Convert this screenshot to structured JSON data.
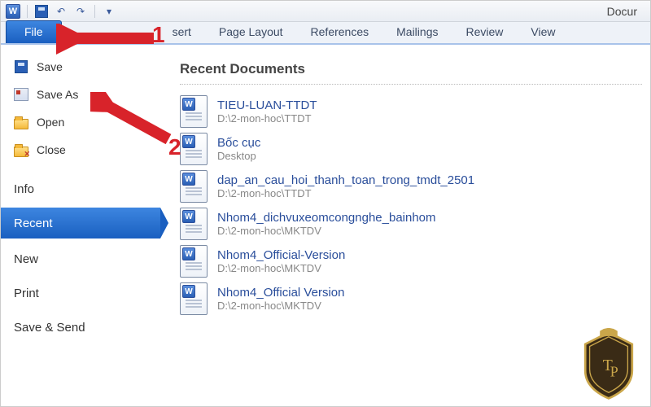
{
  "titlebar": {
    "app_letter": "W",
    "doc_title": "Docur"
  },
  "qat": {
    "save": "save",
    "undo": "↶",
    "redo": "↷"
  },
  "ribbon": {
    "file": "File",
    "insert_cut": "sert",
    "tabs": [
      "Page Layout",
      "References",
      "Mailings",
      "Review",
      "View"
    ]
  },
  "sidebar": {
    "save": "Save",
    "save_as": "Save As",
    "open": "Open",
    "close": "Close",
    "info": "Info",
    "recent": "Recent",
    "new": "New",
    "print": "Print",
    "save_send": "Save & Send"
  },
  "content": {
    "heading": "Recent Documents",
    "docs": [
      {
        "title": "TIEU-LUAN-TTDT",
        "path": "D:\\2-mon-hoc\\TTDT"
      },
      {
        "title": "Bốc cục",
        "path": "Desktop"
      },
      {
        "title": "dap_an_cau_hoi_thanh_toan_trong_tmdt_2501",
        "path": "D:\\2-mon-hoc\\TTDT"
      },
      {
        "title": "Nhom4_dichvuxeomcongnghe_bainhom",
        "path": "D:\\2-mon-hoc\\MKTDV"
      },
      {
        "title": "Nhom4_Official-Version",
        "path": "D:\\2-mon-hoc\\MKTDV"
      },
      {
        "title": "Nhom4_Official Version",
        "path": "D:\\2-mon-hoc\\MKTDV"
      }
    ]
  },
  "annotations": {
    "one": "1",
    "two": "2"
  }
}
